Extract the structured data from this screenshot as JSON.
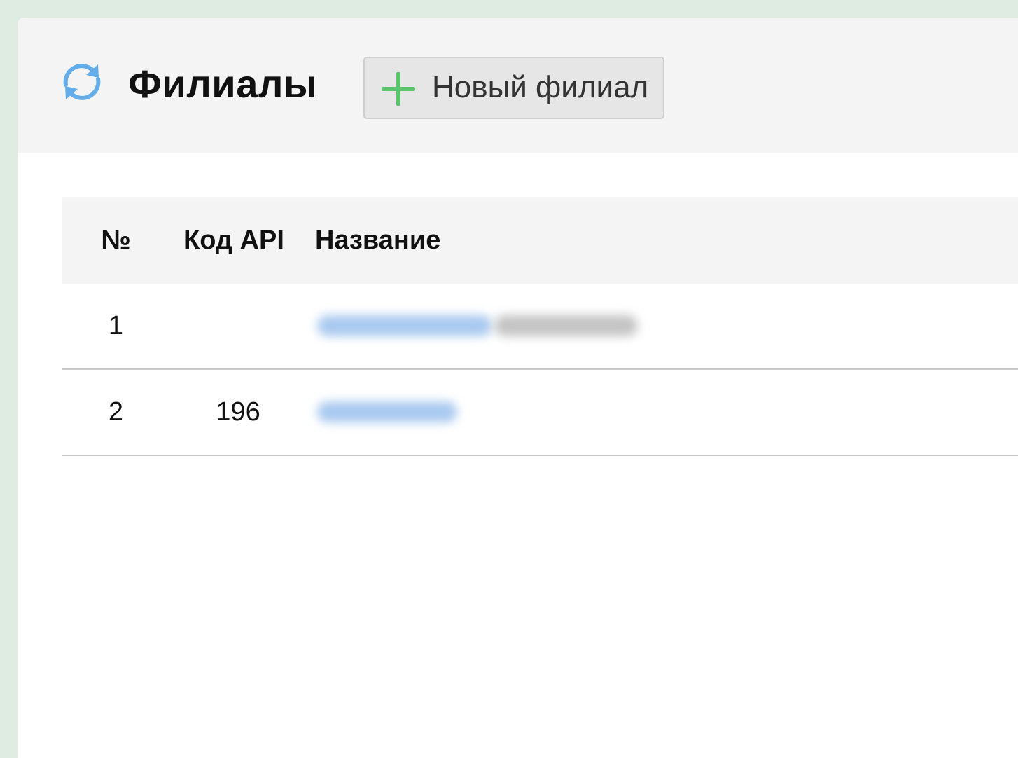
{
  "header": {
    "title": "Филиалы",
    "new_button_label": "Новый филиал"
  },
  "icons": {
    "refresh": "refresh-icon",
    "plus": "plus-icon"
  },
  "colors": {
    "refresh_icon": "#63aeea",
    "plus_icon": "#5cc46d",
    "link_blurred": "#a9c9ef"
  },
  "table": {
    "columns": [
      "№",
      "Код API",
      "Название"
    ],
    "rows": [
      {
        "num": "1",
        "api_code": "",
        "name": ""
      },
      {
        "num": "2",
        "api_code": "196",
        "name": ""
      }
    ]
  }
}
